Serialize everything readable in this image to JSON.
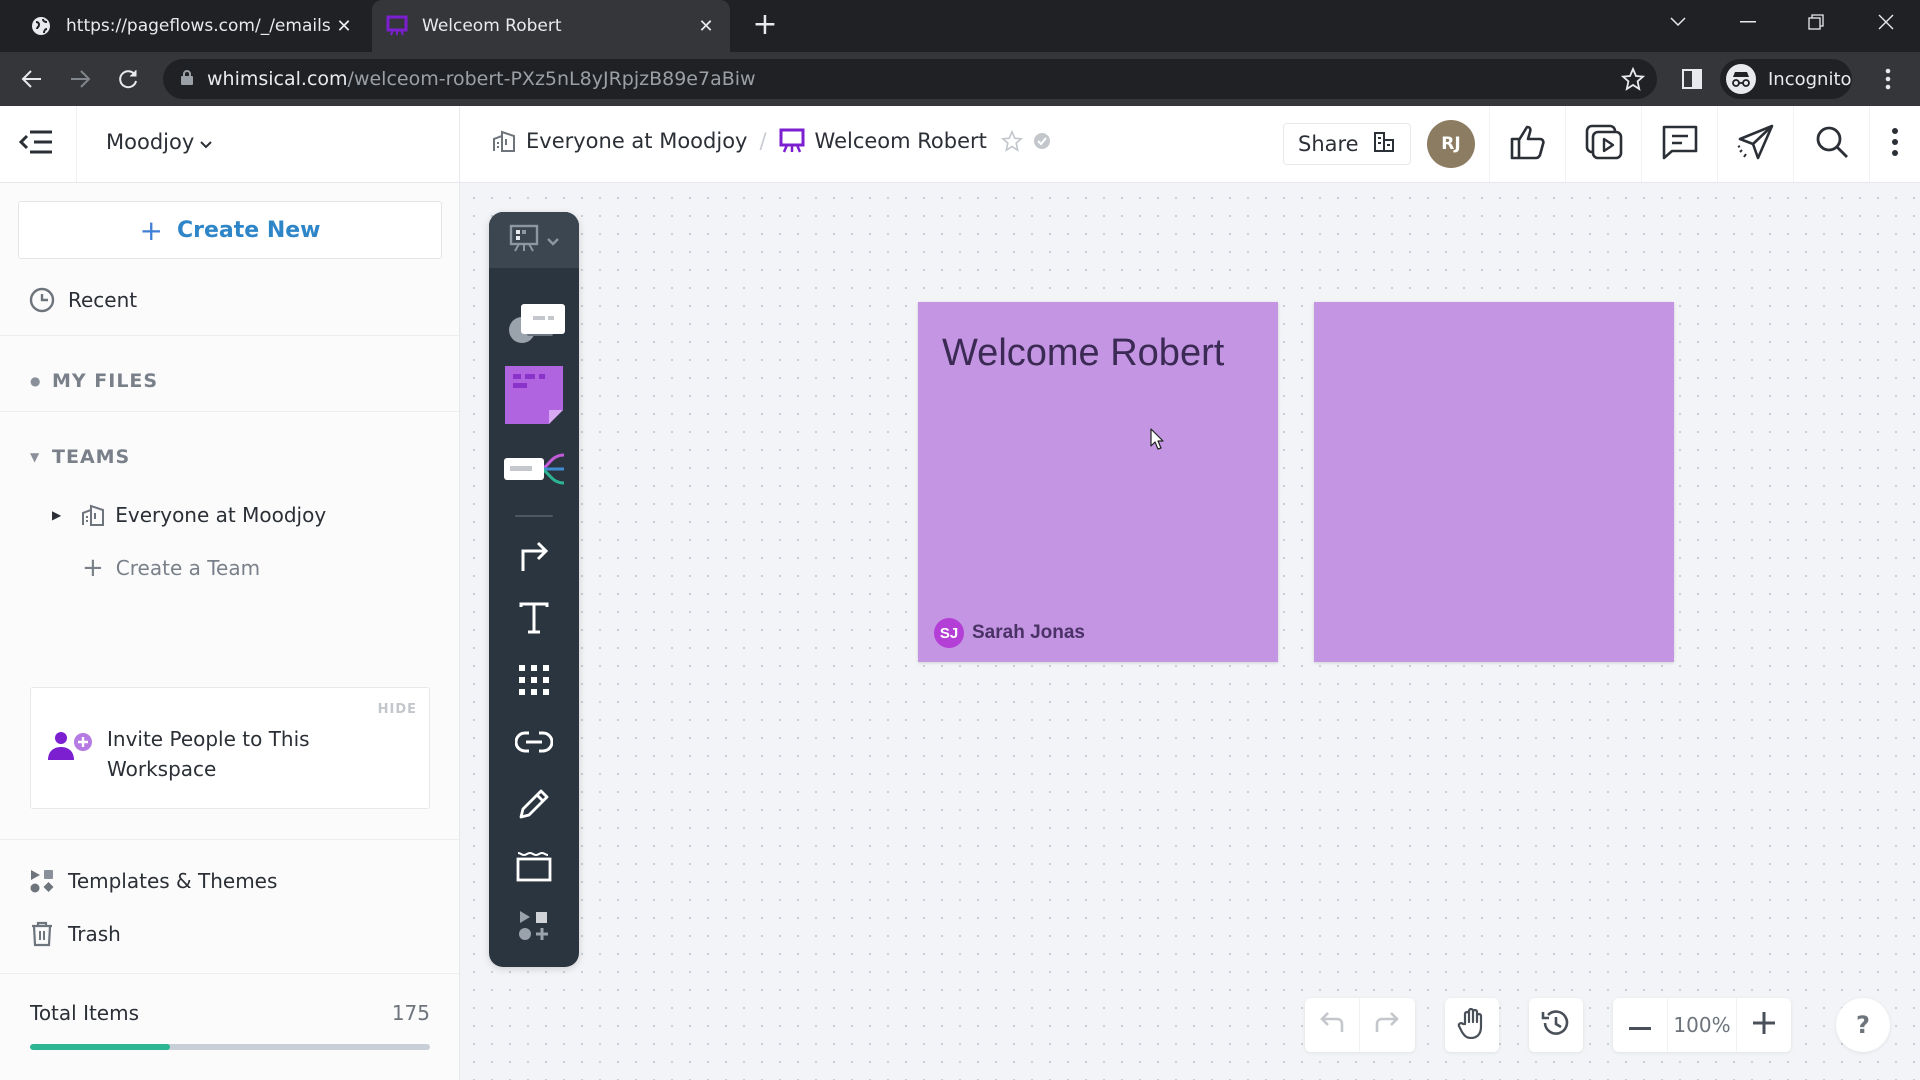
{
  "browser": {
    "tabs": [
      {
        "title": "https://pageflows.com/_/emails/_",
        "favicon": "globe-icon",
        "active": false
      },
      {
        "title": "Welceom Robert",
        "favicon": "whimsical-board-icon",
        "active": true
      }
    ],
    "url": {
      "host": "whimsical.com",
      "path": "/welceom-robert-PXz5nL8yJRpjzB89e7aBiw"
    },
    "profile_label": "Incognito"
  },
  "header": {
    "workspace": "Moodjoy",
    "breadcrumb": [
      {
        "label": "Everyone at Moodjoy",
        "icon": "team-building-icon"
      },
      {
        "label": "Welceom Robert",
        "icon": "board-icon"
      }
    ],
    "breadcrumb_separator": "/",
    "share_label": "Share",
    "user_initials": "RJ",
    "user_avatar_color": "#8c7c62"
  },
  "sidebar": {
    "create_new_label": "Create New",
    "recent_label": "Recent",
    "my_files_label": "MY FILES",
    "teams_label": "TEAMS",
    "teams": [
      {
        "label": "Everyone at Moodjoy"
      }
    ],
    "create_team_label": "Create a Team",
    "invite": {
      "text": "Invite People to This Workspace",
      "hide_label": "HIDE"
    },
    "templates_label": "Templates & Themes",
    "trash_label": "Trash",
    "total_items_label": "Total Items",
    "total_items_count": "175",
    "usage_fraction": 0.35
  },
  "toolbar": {
    "tools": [
      "board-switcher",
      "comment-card",
      "sticky-note",
      "mind-map",
      "connector",
      "text",
      "grid",
      "link",
      "pencil",
      "section",
      "more-shapes"
    ]
  },
  "canvas": {
    "sticky_color": "#c495e3",
    "stickies": [
      {
        "title": "Welcome Robert",
        "author_initials": "SJ",
        "author_name": "Sarah Jonas"
      },
      {
        "title": "",
        "author_initials": "",
        "author_name": ""
      }
    ]
  },
  "controls": {
    "zoom_level": "100%",
    "help_label": "?"
  },
  "colors": {
    "accent_blue": "#2e86c9",
    "purple": "#7b1fd1",
    "progress_green": "#2bb592"
  }
}
